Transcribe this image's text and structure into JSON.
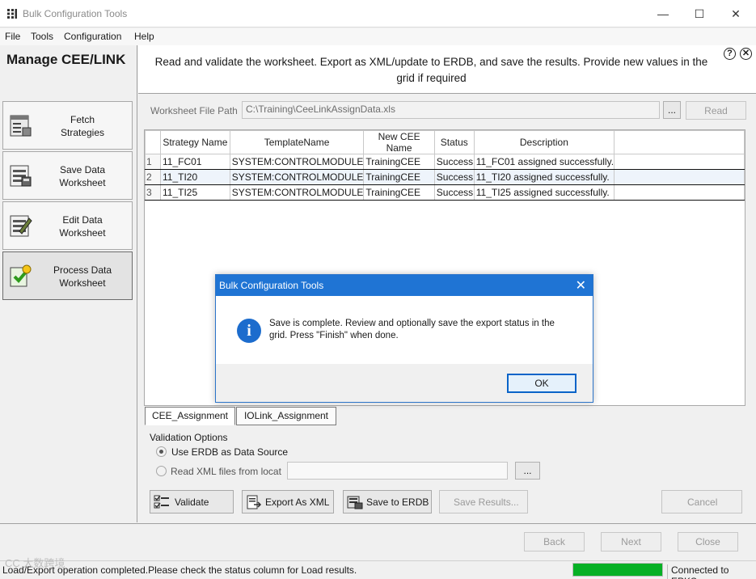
{
  "window": {
    "title": "Bulk Configuration Tools",
    "minimize": "—",
    "maximize": "☐",
    "close": "✕"
  },
  "menu": [
    "File",
    "Tools",
    "Configuration",
    "Help"
  ],
  "sidebar": {
    "heading": "Manage CEE/LINK",
    "items": [
      {
        "line1": "Fetch",
        "line2": "Strategies",
        "icon": "fetch-strategies-icon"
      },
      {
        "line1": "Save Data",
        "line2": "Worksheet",
        "icon": "save-worksheet-icon"
      },
      {
        "line1": "Edit Data",
        "line2": "Worksheet",
        "icon": "edit-worksheet-icon"
      },
      {
        "line1": "Process Data",
        "line2": "Worksheet",
        "icon": "process-worksheet-icon"
      }
    ]
  },
  "header": {
    "line1": "Read and validate the worksheet.  Export as XML/update to ERDB, and save the results. Provide new values in the",
    "line2": "grid if required",
    "help": "?",
    "close": "✕"
  },
  "file": {
    "label": "Worksheet File Path",
    "value": "C:\\Training\\CeeLinkAssignData.xls",
    "browse": "...",
    "read": "Read"
  },
  "grid": {
    "columns": [
      "Strategy Name",
      "TemplateName",
      "New CEE Name",
      "Status",
      "Description"
    ],
    "rows": [
      {
        "n": "1",
        "cells": [
          "11_FC01",
          "SYSTEM:CONTROLMODULE",
          "TrainingCEE",
          "Success",
          "11_FC01 assigned successfully."
        ]
      },
      {
        "n": "2",
        "cells": [
          "11_TI20",
          "SYSTEM:CONTROLMODULE",
          "TrainingCEE",
          "Success",
          "11_TI20 assigned successfully."
        ]
      },
      {
        "n": "3",
        "cells": [
          "11_TI25",
          "SYSTEM:CONTROLMODULE",
          "TrainingCEE",
          "Success",
          "11_TI25 assigned successfully."
        ]
      }
    ]
  },
  "tabs": [
    "CEE_Assignment",
    "IOLink_Assignment"
  ],
  "validation": {
    "title": "Validation Options",
    "option1": "Use ERDB as Data Source",
    "option2": "Read XML files from locat",
    "browse": "..."
  },
  "actions": {
    "validate": "Validate",
    "export": "Export As XML",
    "save_erdb": "Save to ERDB",
    "save_results": "Save Results...",
    "cancel": "Cancel"
  },
  "wizard": {
    "back": "Back",
    "next": "Next",
    "close": "Close"
  },
  "status": {
    "message": "Load/Export operation completed.Please check the status column for Load results.",
    "progress": 1.0,
    "connection": "Connected to EPKS"
  },
  "dialog": {
    "title": "Bulk Configuration Tools",
    "line1": "Save is complete. Review and optionally save the export status in the",
    "line2": "grid.  Press \"Finish\" when done.",
    "ok": "OK",
    "close": "✕"
  },
  "watermark": "CC 大数跨境",
  "colors": {
    "accent": "#1f74d4",
    "progress": "#06b025"
  }
}
